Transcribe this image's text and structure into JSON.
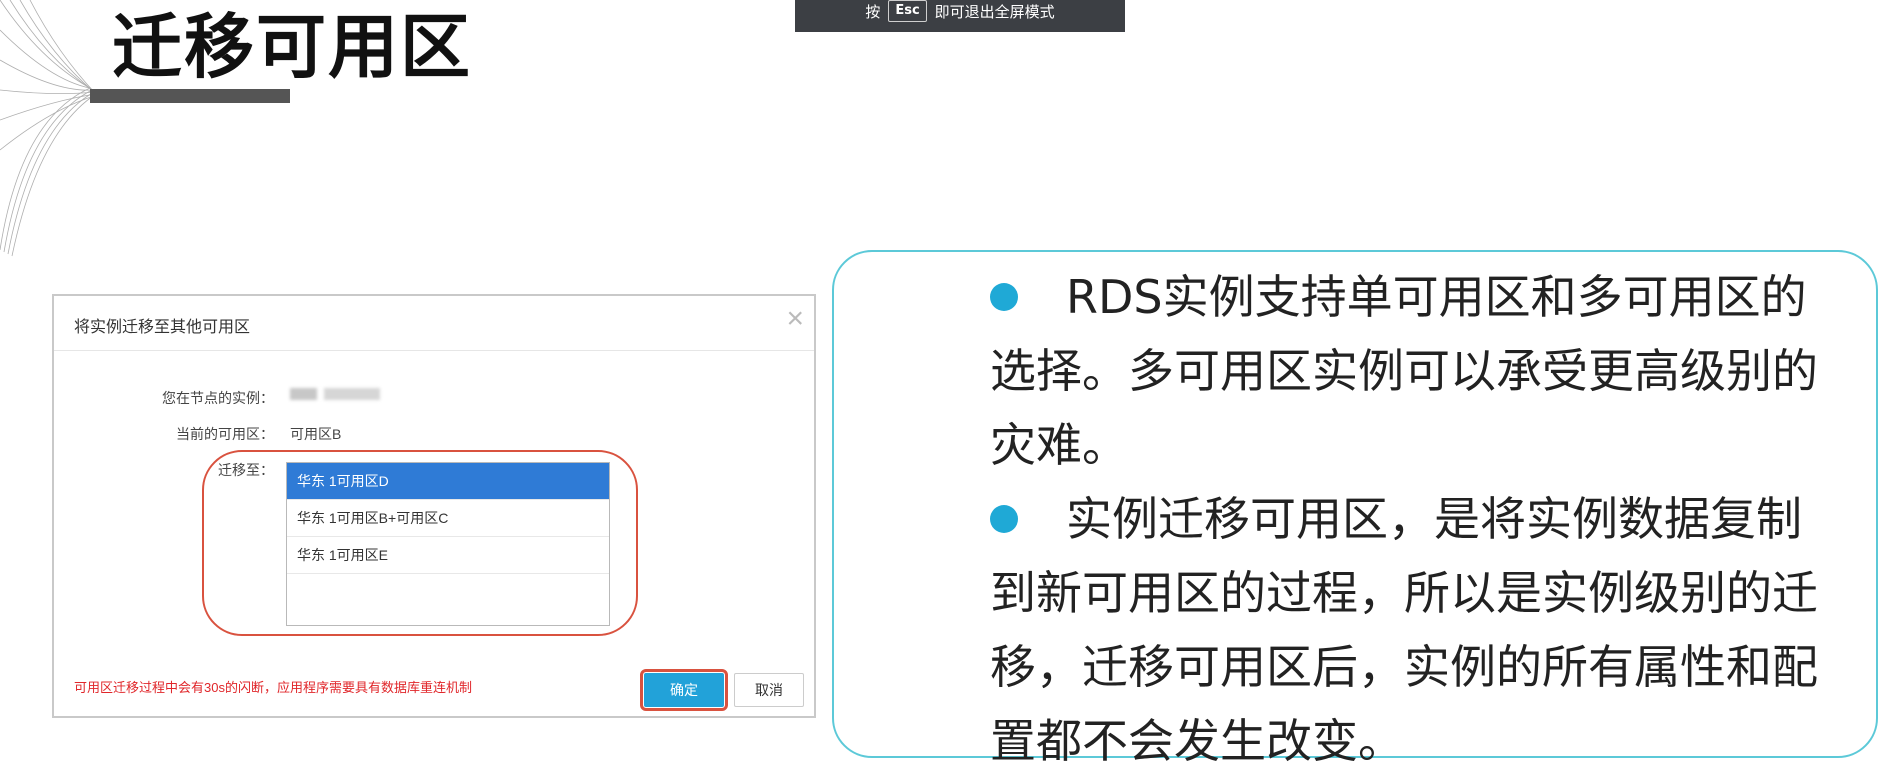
{
  "slide": {
    "title": "迁移可用区"
  },
  "fullscreen_hint": {
    "prefix": "按",
    "key": "Esc",
    "suffix": "即可退出全屏模式"
  },
  "dialog": {
    "title": "将实例迁移至其他可用区",
    "close_icon": "close-icon",
    "fields": {
      "node_instance_label": "您在节点的实例：",
      "current_zone_label": "当前的可用区：",
      "current_zone_value": "可用区B",
      "migrate_to_label": "迁移至："
    },
    "zone_options": [
      {
        "label": "华东 1可用区D",
        "selected": true
      },
      {
        "label": "华东 1可用区B+可用区C",
        "selected": false
      },
      {
        "label": "华东 1可用区E",
        "selected": false
      }
    ],
    "warning": "可用区迁移过程中会有30s的闪断，应用程序需要具有数据库重连机制",
    "confirm_label": "确定",
    "cancel_label": "取消"
  },
  "bullets": [
    "RDS实例支持单可用区和多可用区的选择。多可用区实例可以承受更高级别的灾难。",
    "实例迁移可用区，是将实例数据复制到新可用区的过程，所以是实例级别的迁移，迁移可用区后，实例的所有属性和配置都不会发生改变。"
  ],
  "colors": {
    "accent_cyan": "#1fa9d6",
    "box_border": "#5cc9d8",
    "highlight_red": "#d9523f",
    "selected_blue": "#2f7bd6",
    "confirm_blue": "#22a2d9",
    "warning_red": "#e0262a"
  }
}
